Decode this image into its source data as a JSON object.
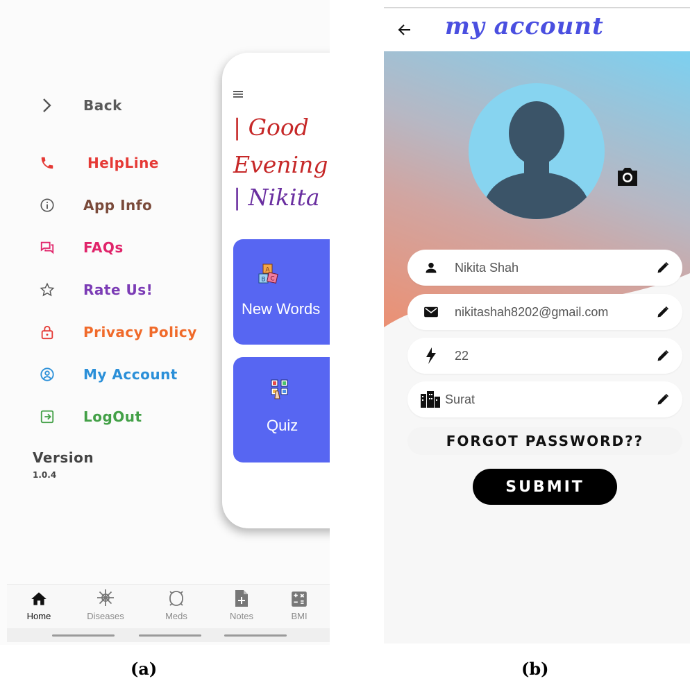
{
  "drawer": {
    "items": [
      {
        "label": "Back",
        "icon": "chevron-right-icon",
        "color": "#5a5a5a"
      },
      {
        "label": "HelpLine",
        "icon": "phone-icon",
        "color": "#e53935"
      },
      {
        "label": "App Info",
        "icon": "info-icon",
        "color": "#7a4a3a"
      },
      {
        "label": "FAQs",
        "icon": "chat-icon",
        "color": "#e0246a"
      },
      {
        "label": "Rate Us!",
        "icon": "star-icon",
        "color": "#7b3bb5"
      },
      {
        "label": "Privacy Policy",
        "icon": "lock-icon",
        "color": "#f06a2a"
      },
      {
        "label": "My Account",
        "icon": "account-circle-icon",
        "color": "#2a8fd8"
      },
      {
        "label": "LogOut",
        "icon": "logout-icon",
        "color": "#43a047"
      }
    ],
    "version_title": "Version",
    "version_number": "1.0.4"
  },
  "home": {
    "greeting_line1": "| Good",
    "greeting_line2": "Evening",
    "greeting_line3": "| Nikita",
    "tiles": [
      {
        "label": "New Words",
        "icon": "abc-blocks-icon"
      },
      {
        "label": "Quiz",
        "icon": "quiz-icon"
      }
    ]
  },
  "bottom_nav": {
    "items": [
      {
        "label": "Home",
        "icon": "home-icon",
        "active": true
      },
      {
        "label": "Diseases",
        "icon": "virus-icon",
        "active": false
      },
      {
        "label": "Meds",
        "icon": "pill-icon",
        "active": false
      },
      {
        "label": "Notes",
        "icon": "note-add-icon",
        "active": false
      },
      {
        "label": "BMI",
        "icon": "calculator-icon",
        "active": false
      }
    ]
  },
  "account": {
    "title": "my account",
    "fields": [
      {
        "icon": "person-icon",
        "value": "Nikita Shah"
      },
      {
        "icon": "email-icon",
        "value": "nikitashah8202@gmail.com"
      },
      {
        "icon": "bolt-icon",
        "value": "22"
      },
      {
        "icon": "city-icon",
        "value": "Surat"
      }
    ],
    "forgot_label": "FORGOT PASSWORD??",
    "submit_label": "SUBMIT"
  },
  "captions": {
    "a": "(a)",
    "b": "(b)"
  },
  "colors": {
    "tile_blue": "#5766f2",
    "title_blue": "#4a4fe0",
    "greeting_red": "#c62828",
    "greeting_purple": "#6a2fa0"
  }
}
